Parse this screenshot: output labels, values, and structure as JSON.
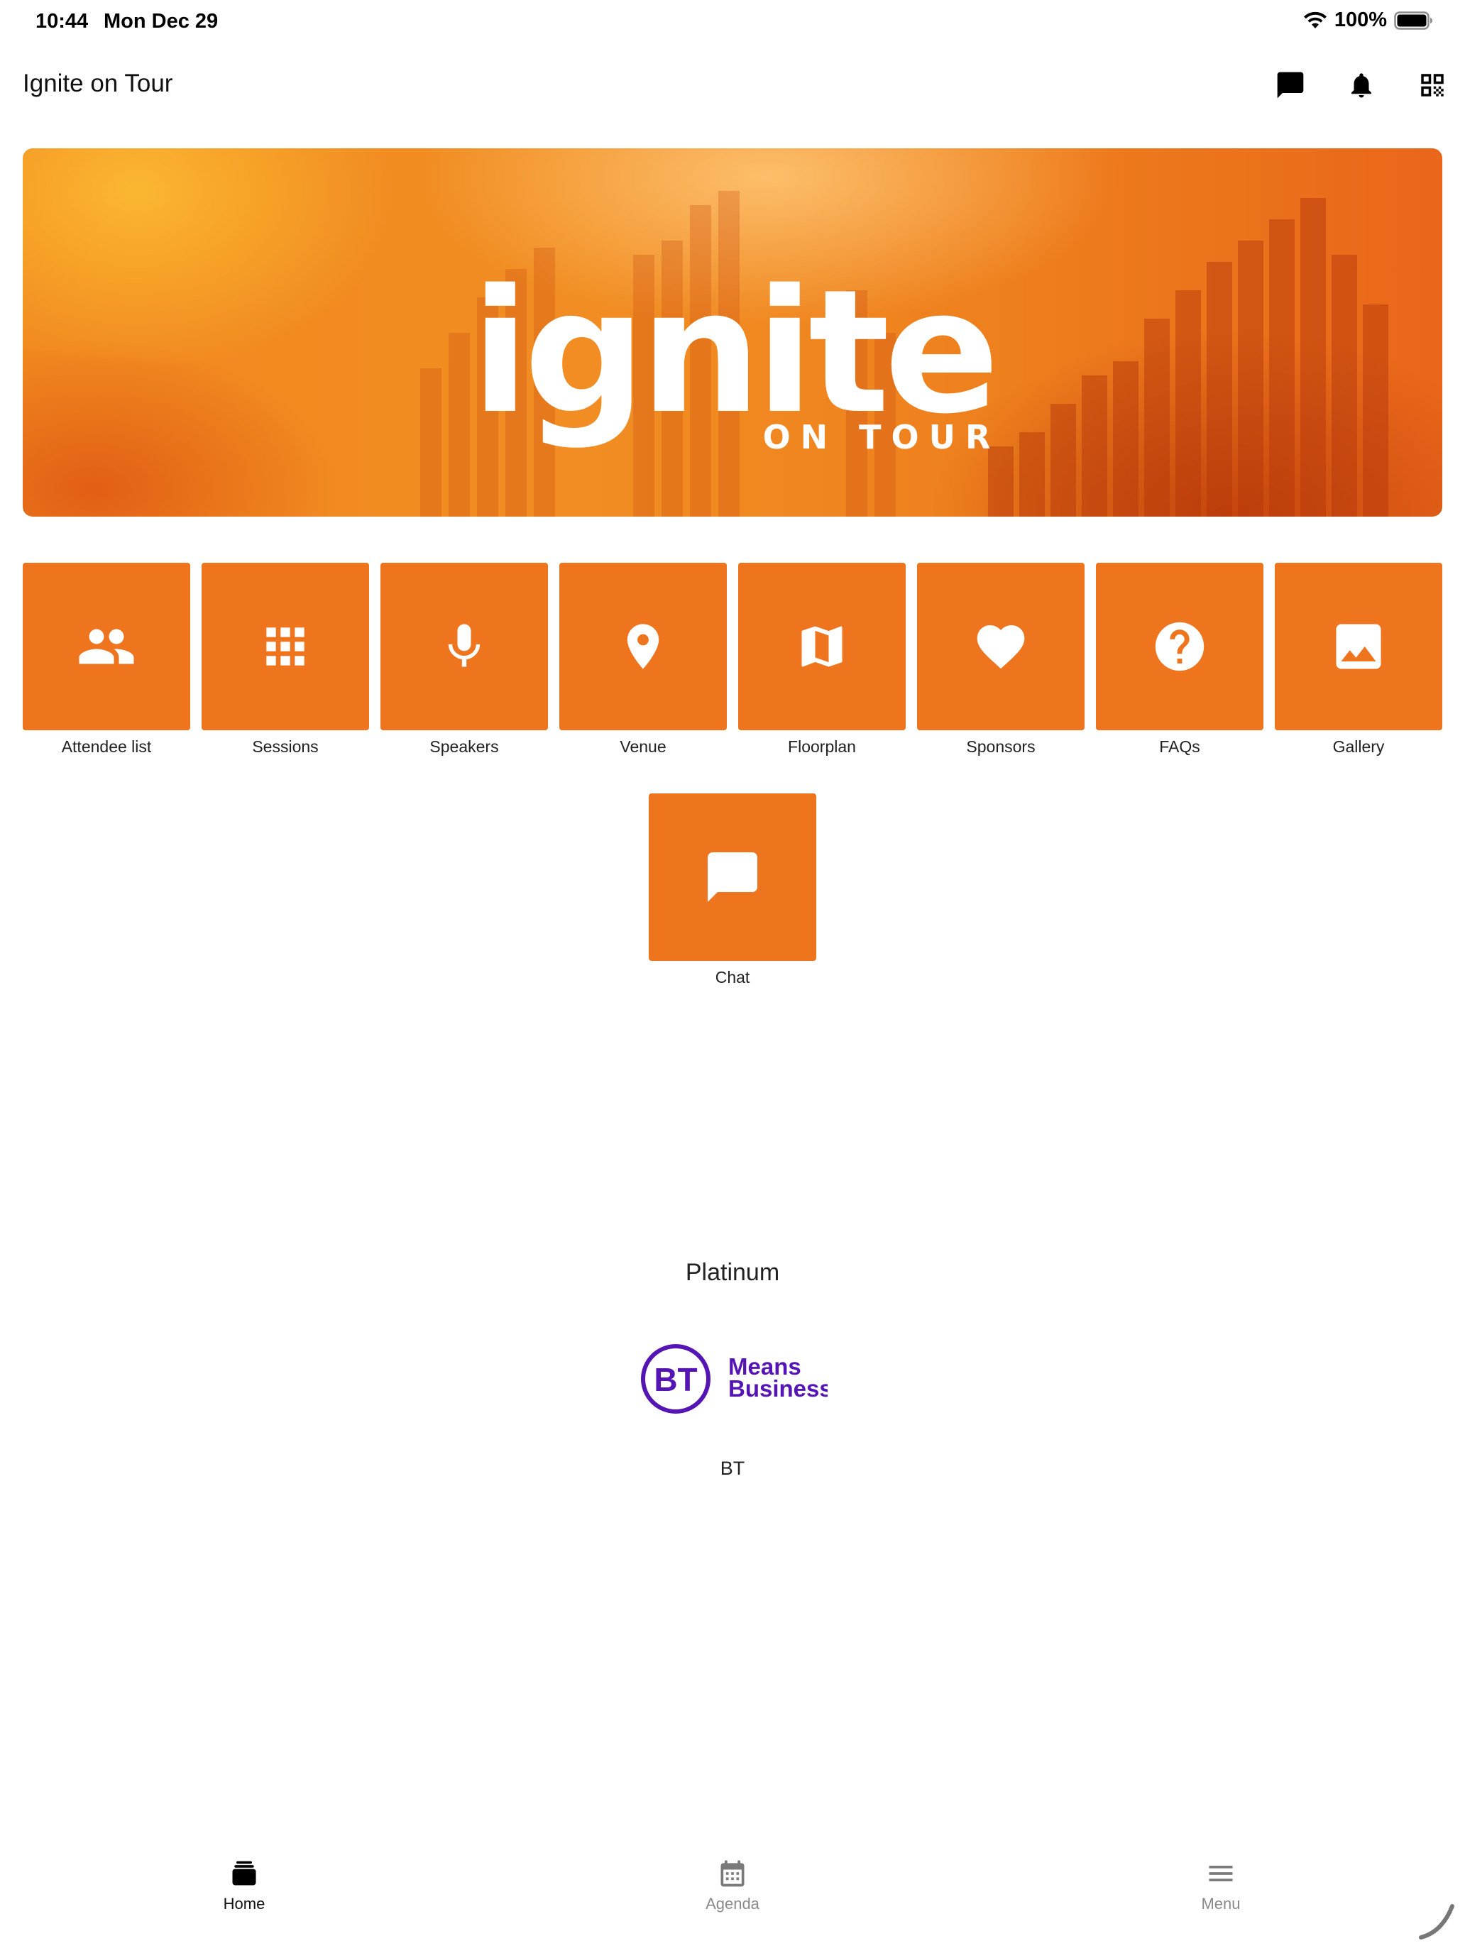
{
  "status_bar": {
    "time": "10:44",
    "date": "Mon Dec 29",
    "battery": "100%"
  },
  "header": {
    "title": "Ignite on Tour",
    "icons": [
      "chat-bubble-icon",
      "bell-icon",
      "qr-code-icon"
    ]
  },
  "banner": {
    "logo_text": "ignite",
    "logo_subtitle": "ON TOUR"
  },
  "tiles": [
    {
      "label": "Attendee list",
      "icon": "people-icon"
    },
    {
      "label": "Sessions",
      "icon": "grid-icon"
    },
    {
      "label": "Speakers",
      "icon": "microphone-icon"
    },
    {
      "label": "Venue",
      "icon": "location-pin-icon"
    },
    {
      "label": "Floorplan",
      "icon": "map-icon"
    },
    {
      "label": "Sponsors",
      "icon": "heart-icon"
    },
    {
      "label": "FAQs",
      "icon": "help-circle-icon"
    },
    {
      "label": "Gallery",
      "icon": "image-icon"
    },
    {
      "label": "Chat",
      "icon": "chat-bubble-icon"
    }
  ],
  "sponsors": {
    "tier": "Platinum",
    "logo_line1": "Means",
    "logo_line2": "Business",
    "logo_mark": "BT",
    "name": "BT"
  },
  "bottom_nav": [
    {
      "label": "Home",
      "icon": "home-icon",
      "active": true
    },
    {
      "label": "Agenda",
      "icon": "calendar-icon",
      "active": false
    },
    {
      "label": "Menu",
      "icon": "hamburger-menu-icon",
      "active": false
    }
  ],
  "colors": {
    "tile_orange": "#ef741e",
    "bt_purple": "#5514b4",
    "inactive_gray": "#8a8a8a"
  }
}
